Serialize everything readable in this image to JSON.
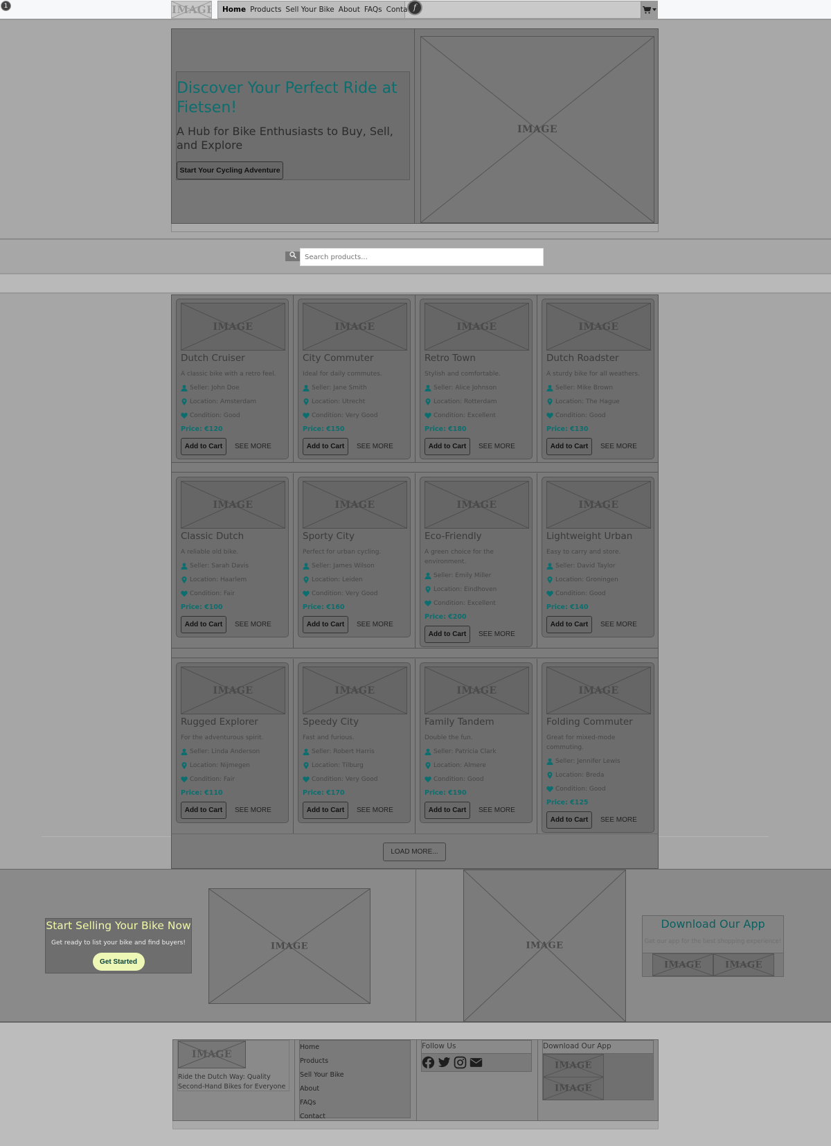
{
  "header": {
    "badge": "1",
    "logo_label": "IMAGE",
    "nav": [
      {
        "label": "Home",
        "active": true
      },
      {
        "label": "Products",
        "active": false
      },
      {
        "label": "Sell Your Bike",
        "active": false
      },
      {
        "label": "About",
        "active": false
      },
      {
        "label": "FAQs",
        "active": false
      },
      {
        "label": "Contact",
        "active": false
      }
    ],
    "f_badge": "f",
    "cart_icon": "cart-icon"
  },
  "hero": {
    "title": "Discover Your Perfect Ride at Fietsen!",
    "subtitle": "A Hub for Bike Enthusiasts to Buy, Sell, and Explore",
    "cta": "Start Your Cycling Adventure",
    "image_label": "IMAGE"
  },
  "search": {
    "placeholder": "Search products...",
    "icon": "search-icon"
  },
  "products": {
    "image_label": "IMAGE",
    "add_to_cart": "Add to Cart",
    "see_more": "SEE MORE",
    "seller_prefix": "Seller: ",
    "location_prefix": "Location: ",
    "condition_prefix": "Condition: ",
    "price_prefix": "Price: ",
    "items": [
      {
        "title": "Dutch Cruiser",
        "desc": "A classic bike with a retro feel.",
        "seller": "John Doe",
        "location": "Amsterdam",
        "condition": "Good",
        "price": "€120"
      },
      {
        "title": "City Commuter",
        "desc": "Ideal for daily commutes.",
        "seller": "Jane Smith",
        "location": "Utrecht",
        "condition": "Very Good",
        "price": "€150"
      },
      {
        "title": "Retro Town",
        "desc": "Stylish and comfortable.",
        "seller": "Alice Johnson",
        "location": "Rotterdam",
        "condition": "Excellent",
        "price": "€180"
      },
      {
        "title": "Dutch Roadster",
        "desc": "A sturdy bike for all weathers.",
        "seller": "Mike Brown",
        "location": "The Hague",
        "condition": "Good",
        "price": "€130"
      },
      {
        "title": "Classic Dutch",
        "desc": "A reliable old bike.",
        "seller": "Sarah Davis",
        "location": "Haarlem",
        "condition": "Fair",
        "price": "€100"
      },
      {
        "title": "Sporty City",
        "desc": "Perfect for urban cycling.",
        "seller": "James Wilson",
        "location": "Leiden",
        "condition": "Very Good",
        "price": "€160"
      },
      {
        "title": "Eco-Friendly",
        "desc": "A green choice for the environment.",
        "seller": "Emily Miller",
        "location": "Eindhoven",
        "condition": "Excellent",
        "price": "€200"
      },
      {
        "title": "Lightweight Urban",
        "desc": "Easy to carry and store.",
        "seller": "David Taylor",
        "location": "Groningen",
        "condition": "Good",
        "price": "€140"
      },
      {
        "title": "Rugged Explorer",
        "desc": "For the adventurous spirit.",
        "seller": "Linda Anderson",
        "location": "Nijmegen",
        "condition": "Fair",
        "price": "€110"
      },
      {
        "title": "Speedy City",
        "desc": "Fast and furious.",
        "seller": "Robert Harris",
        "location": "Tilburg",
        "condition": "Very Good",
        "price": "€170"
      },
      {
        "title": "Family Tandem",
        "desc": "Double the fun.",
        "seller": "Patricia Clark",
        "location": "Almere",
        "condition": "Good",
        "price": "€190"
      },
      {
        "title": "Folding Commuter",
        "desc": "Great for mixed-mode commuting.",
        "seller": "Jennifer Lewis",
        "location": "Breda",
        "condition": "Good",
        "price": "€125"
      }
    ],
    "load_more": "LOAD MORE..."
  },
  "promo": {
    "sell_title": "Start Selling Your Bike Now",
    "sell_desc": "Get ready to list your bike and find buyers!",
    "sell_cta": "Get Started",
    "image_label": "IMAGE",
    "app_title": "Download Our App",
    "app_desc": "Get our app for the best shopping experience!"
  },
  "footer": {
    "logo_label": "IMAGE",
    "tagline": "Ride the Dutch Way: Quality Second-Hand Bikes for Everyone",
    "links": [
      "Home",
      "Products",
      "Sell Your Bike",
      "About",
      "FAQs",
      "Contact"
    ],
    "follow_title": "Follow Us",
    "social": [
      "facebook-icon",
      "twitter-icon",
      "instagram-icon",
      "email-icon"
    ],
    "app_title": "Download Our App",
    "store_label": "IMAGE"
  },
  "colors": {
    "accent_teal": "#0c6e6e",
    "cta_yellow": "#eef7b6",
    "sell_title_yellow": "#f0f7a8"
  }
}
